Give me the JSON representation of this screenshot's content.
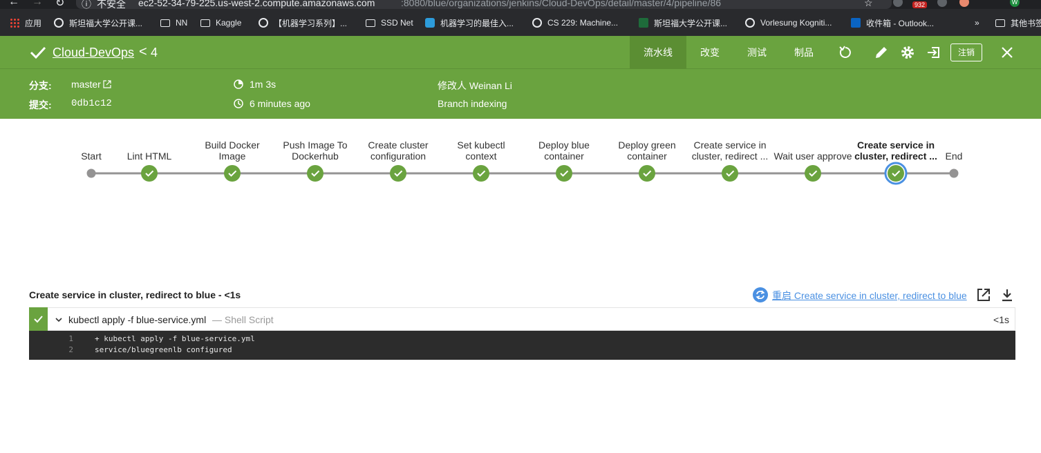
{
  "browser": {
    "url_host": "ec2-52-34-79-225.us-west-2.compute.amazonaws.com",
    "url_path": ":8080/blue/organizations/jenkins/Cloud-DevOps/detail/master/4/pipeline/86",
    "security_label": "不安全",
    "badge": "932",
    "profile_initial": "W"
  },
  "bookmarks": [
    {
      "icon": "apps-grid-icon",
      "label": "应用"
    },
    {
      "icon": "globe-icon",
      "label": "斯坦福大学公开课..."
    },
    {
      "icon": "folder-icon",
      "label": "NN"
    },
    {
      "icon": "folder-icon",
      "label": "Kaggle"
    },
    {
      "icon": "globe-icon",
      "label": "【机器学习系列】..."
    },
    {
      "icon": "folder-icon",
      "label": "SSD Net"
    },
    {
      "icon": "site-icon",
      "label": "机器学习的最佳入..."
    },
    {
      "icon": "globe-icon",
      "label": "CS 229: Machine..."
    },
    {
      "icon": "play-icon",
      "label": "斯坦福大学公开课..."
    },
    {
      "icon": "globe-icon",
      "label": "Vorlesung Kogniti..."
    },
    {
      "icon": "outlook-icon",
      "label": "收件箱 - Outlook..."
    },
    {
      "icon": "chevron-right-icon",
      "label": "»"
    },
    {
      "icon": "folder-icon",
      "label": "其他书签"
    }
  ],
  "header": {
    "pipeline_name": "Cloud-DevOps",
    "lt": "<",
    "run_number": "4",
    "tabs": [
      "流水线",
      "改变",
      "测试",
      "制品"
    ],
    "logout_label": "注销",
    "branch_label": "分支:",
    "branch_value": "master",
    "commit_label": "提交:",
    "commit_value": "0db1c12",
    "duration": "1m 3s",
    "time_ago": "6 minutes ago",
    "changes_by": "修改人 Weinan Li",
    "cause": "Branch indexing"
  },
  "colors": {
    "brand_green": "#6aa33f",
    "active_tab": "#5b8e33",
    "selected_ring": "#4a90e2",
    "link_blue": "#4a90e2",
    "log_bg": "#2c2c2c"
  },
  "stages": [
    {
      "label1": "",
      "label2": "Start",
      "status": "start"
    },
    {
      "label1": "",
      "label2": "Lint HTML",
      "status": "success"
    },
    {
      "label1": "Build Docker",
      "label2": "Image",
      "status": "success"
    },
    {
      "label1": "Push Image To",
      "label2": "Dockerhub",
      "status": "success"
    },
    {
      "label1": "Create cluster",
      "label2": "configuration",
      "status": "success"
    },
    {
      "label1": "Set kubectl",
      "label2": "context",
      "status": "success"
    },
    {
      "label1": "Deploy blue",
      "label2": "container",
      "status": "success"
    },
    {
      "label1": "Deploy green",
      "label2": "container",
      "status": "success"
    },
    {
      "label1": "Create service in",
      "label2": "cluster, redirect ...",
      "status": "success"
    },
    {
      "label1": "",
      "label2": "Wait user approve",
      "status": "success"
    },
    {
      "label1": "Create service in",
      "label2": "cluster, redirect ...",
      "status": "selected"
    },
    {
      "label1": "",
      "label2": "End",
      "status": "end"
    }
  ],
  "step_detail": {
    "title": "Create service in cluster, redirect to blue - <1s",
    "restart_label": "重启 Create service in cluster, redirect to blue",
    "step_command": "kubectl apply -f blue-service.yml",
    "step_type": "— Shell Script",
    "step_time": "<1s",
    "log_lines": [
      {
        "n": "1",
        "text": "+ kubectl apply -f blue-service.yml"
      },
      {
        "n": "2",
        "text": "service/bluegreenlb configured"
      }
    ]
  }
}
